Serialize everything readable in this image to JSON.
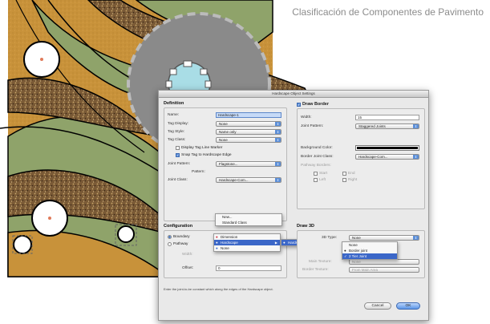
{
  "header": {
    "title": "Clasificación de Componentes de Pavimento"
  },
  "colors": {
    "paver_orange": "#c8923a",
    "paver_green": "#8fa36a",
    "paver_brown": "#7a5a36",
    "accent": "#3b67c8",
    "disc": "#8a8a8a"
  },
  "dialog": {
    "title": "Hardscape Object Settings",
    "definition": {
      "section": "Definition",
      "name_label": "Name:",
      "name_value": "Hardscape-1",
      "tag_display_label": "Tag Display:",
      "tag_display_value": "None",
      "tag_style_label": "Tag Style:",
      "tag_style_value": "Name only",
      "tag_class_label": "Tag Class:",
      "tag_class_value": "None",
      "display_tag_line_marker": "Display Tag Line Marker",
      "snap_tag_label": "Snap Tag to Hardscape Edge",
      "joint_pattern_label": "Joint Pattern:",
      "joint_pattern_value": "Flagstone...",
      "pattern_label": "Pattern:",
      "joint_class_label": "Joint Class:",
      "joint_class_value": "Hardscape-Com..."
    },
    "configuration": {
      "section": "Configuration",
      "boundary": "Boundary",
      "pathway": "Pathway",
      "width_label": "Width:",
      "offset_label": "Offset:",
      "offset_value": "0"
    },
    "draw_border": {
      "checkbox": "Draw Border",
      "width_label": "Width:",
      "width_value": "15",
      "joint_pattern_label": "Joint Pattern:",
      "joint_pattern_value": "Staggered Joints",
      "background_color_label": "Background Color:",
      "border_joint_class_label": "Border Joint Class:",
      "border_joint_class_value": "Hardscape-Com...",
      "pathway_borders_label": "Pathway Borders:",
      "start": "Start",
      "end": "End",
      "left": "Left",
      "right": "Right"
    },
    "draw_3d": {
      "section": "Draw 3D",
      "three_d_type_label": "3D Type:",
      "three_d_type_value": "None",
      "main_texture_label": "Main Texture:",
      "main_texture_value": "None",
      "border_texture_label": "Border Texture:",
      "border_texture_value": "From Main Area"
    },
    "joint_class_menu": [
      "New...",
      "Standard Class"
    ],
    "class_menu": [
      "Dimension",
      "Hardscape",
      "None"
    ],
    "class_submenu": [
      "Hardscape"
    ],
    "type_menu": [
      "None",
      "Border joint",
      "2 Tier Joint"
    ],
    "status_text": "Enter the joint-to-be constant which along the edges of the Hardscape object.",
    "cancel": "Cancel",
    "ok": "OK"
  }
}
